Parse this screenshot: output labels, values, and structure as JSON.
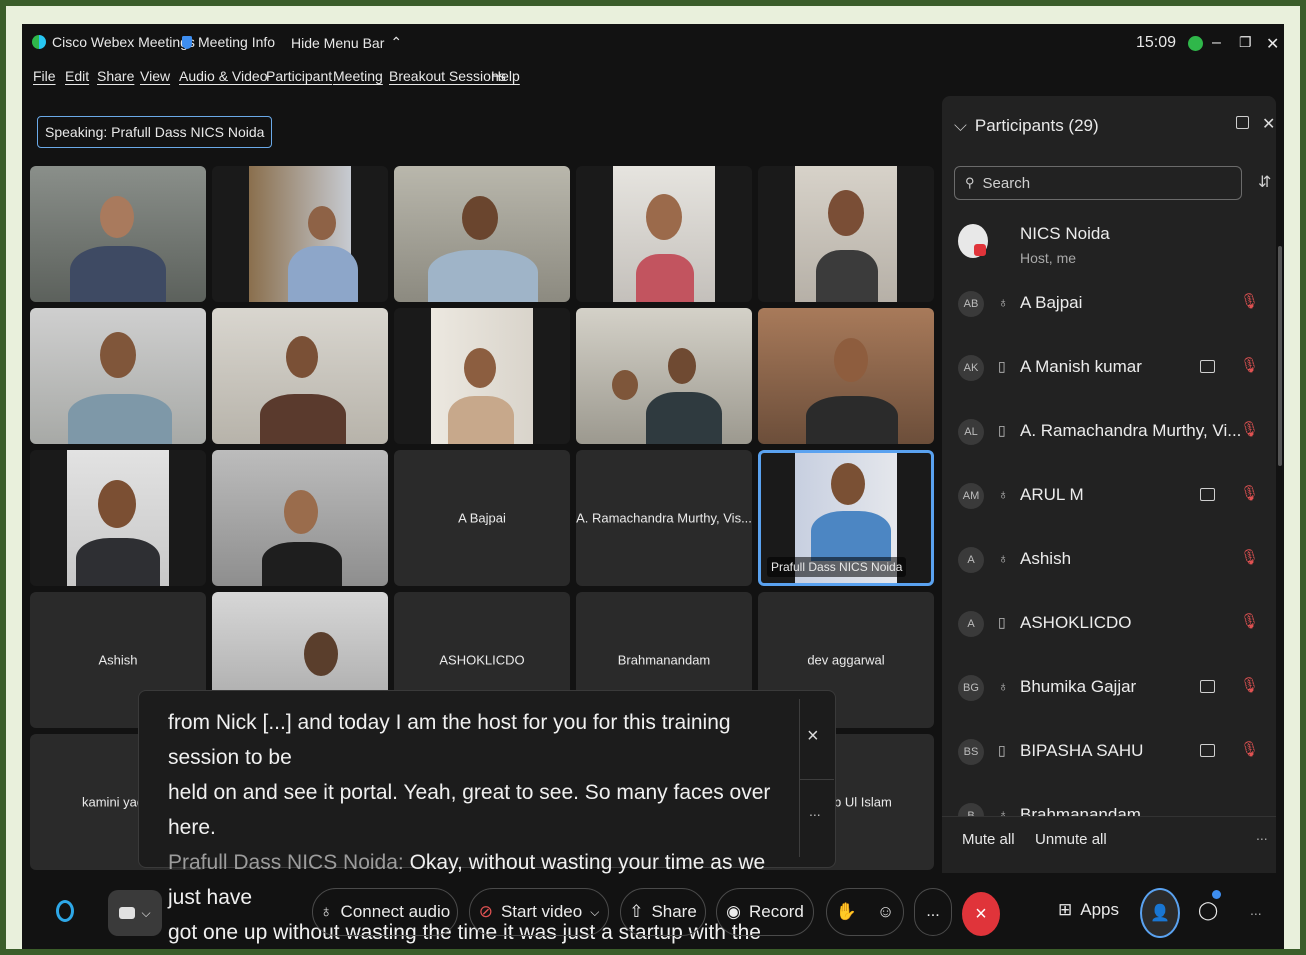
{
  "titlebar": {
    "app_name": "Cisco Webex Meetings",
    "meeting_info": "Meeting Info",
    "hide_menu": "Hide Menu Bar",
    "time": "15:09"
  },
  "menu": [
    "File",
    "Edit",
    "Share",
    "View",
    "Audio & Video",
    "Participant",
    "Meeting",
    "Breakout Sessions",
    "Help"
  ],
  "speaking": {
    "label": "Speaking:",
    "name": "Prafull Dass NICS Noida"
  },
  "tiles": {
    "a_bajpai": "A Bajpai",
    "ramachandra": "A. Ramachandra Murthy, Vis...",
    "prafull": "Prafull Dass NICS Noida",
    "ashish": "Ashish",
    "ashoklicdo": "ASHOKLICDO",
    "brahmanandam": "Brahmanandam",
    "dev": "dev aggarwal",
    "kamini": "kamini yad",
    "ul_islam": "b Ul Islam"
  },
  "caption": {
    "line1": "from Nick [...] and today I am the host for you for this training session to be",
    "line2": "held on and see it portal. Yeah, great to see. So many faces over here.",
    "speaker": "Prafull Dass NICS Noida:",
    "line3": " Okay, without wasting your time as we just have",
    "line4": "got one up without wasting the time it was just a startup with the",
    "close": "×",
    "more": "..."
  },
  "participants": {
    "title": "Participants (29)",
    "search_placeholder": "Search",
    "host": {
      "name": "NICS Noida",
      "role": "Host, me"
    },
    "list": [
      {
        "initials": "AB",
        "name": "A Bajpai",
        "device": "headset",
        "camera": false
      },
      {
        "initials": "AK",
        "name": "A Manish kumar",
        "device": "phone",
        "camera": true
      },
      {
        "initials": "AL",
        "name": "A. Ramachandra Murthy, Vi...",
        "device": "phone",
        "camera": false
      },
      {
        "initials": "AM",
        "name": "ARUL M",
        "device": "headset",
        "camera": true
      },
      {
        "initials": "A",
        "name": "Ashish",
        "device": "headset",
        "camera": false
      },
      {
        "initials": "A",
        "name": "ASHOKLICDO",
        "device": "phone",
        "camera": false
      },
      {
        "initials": "BG",
        "name": "Bhumika Gajjar",
        "device": "headset",
        "camera": true
      },
      {
        "initials": "BS",
        "name": "BIPASHA SAHU",
        "device": "phone",
        "camera": true
      },
      {
        "initials": "B",
        "name": "Brahmanandam",
        "device": "headset",
        "camera": false
      }
    ],
    "mute_all": "Mute all",
    "unmute_all": "Unmute all",
    "more": "..."
  },
  "bottom": {
    "connect_audio": "Connect audio",
    "start_video": "Start video",
    "share": "Share",
    "record": "Record",
    "more": "...",
    "apps": "Apps",
    "overflow": "...",
    "end_icon": "×"
  },
  "colors": {
    "accent": "#5aa2f0",
    "danger": "#e0343a",
    "mute": "#e05252"
  }
}
